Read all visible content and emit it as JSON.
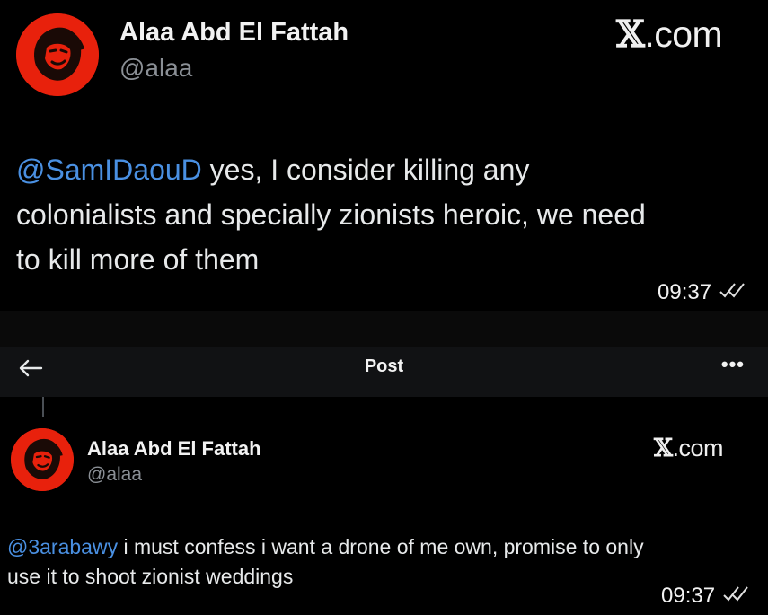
{
  "top_post": {
    "author_name": "Alaa Abd El Fattah",
    "author_handle": "@alaa",
    "brand": "X.com",
    "brand_x": "𝕏",
    "brand_rest": ".com",
    "mention": "@SamIDaouD",
    "text_lines": [
      " yes, I consider killing any",
      "colonialists and specially zionists heroic, we need",
      "to kill more of them"
    ],
    "time": "09:37"
  },
  "nav": {
    "back_icon": "arrow-left-icon",
    "title": "Post",
    "more_icon": "more-icon",
    "more_glyph": "•••"
  },
  "bottom_post": {
    "author_name": "Alaa Abd El Fattah",
    "author_handle": "@alaa",
    "brand_x": "𝕏",
    "brand_rest": ".com",
    "mention": "@3arabawy",
    "text_line_1": " i must confess i want a drone of me own, promise to only",
    "text_line_2": "use it to shoot zionist weddings",
    "time": "09:37"
  },
  "colors": {
    "background": "#000000",
    "mention": "#4a90e2",
    "avatar_red": "#e8210c",
    "handle_gray": "#8b9096"
  }
}
